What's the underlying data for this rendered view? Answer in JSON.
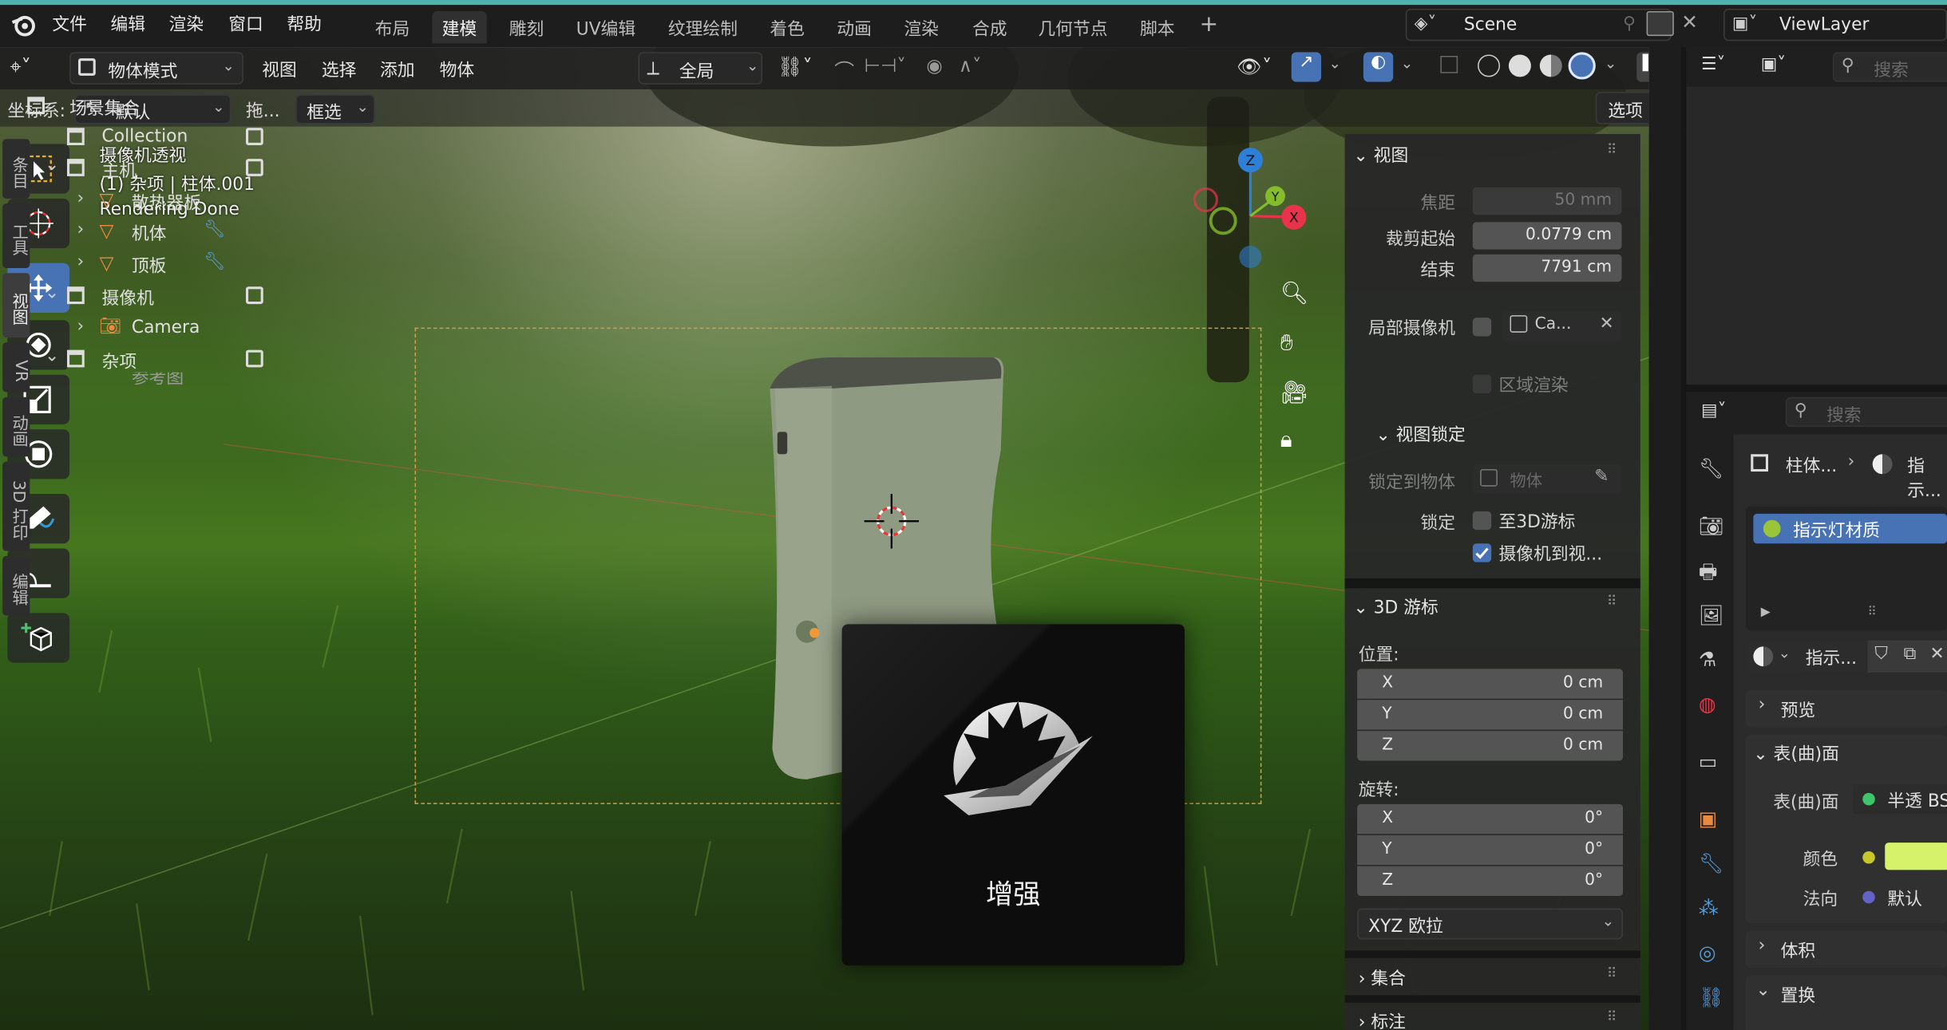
{
  "menubar": {
    "items": [
      "文件",
      "编辑",
      "渲染",
      "窗口",
      "帮助"
    ],
    "workspaces": [
      "布局",
      "建模",
      "雕刻",
      "UV编辑",
      "纹理绘制",
      "着色",
      "动画",
      "渲染",
      "合成",
      "几何节点",
      "脚本"
    ],
    "active_workspace": "建模",
    "scene": "Scene",
    "view_layer": "ViewLayer"
  },
  "viewport_header": {
    "mode": "物体模式",
    "menus": [
      "视图",
      "选择",
      "添加",
      "物体"
    ],
    "transform_orientation": "全局",
    "coord_label": "坐标系:",
    "coord_value": "默认",
    "drag_label": "拖...",
    "select_mode": "框选",
    "options": "选项"
  },
  "hud": {
    "line1": "摄像机透视",
    "line2": "(1) 杂项 | 柱体.001",
    "line3": "Rendering Done"
  },
  "gizmo": {
    "z": "Z",
    "y": "Y",
    "x": "X"
  },
  "n_panel": {
    "view_header": "视图",
    "focal_label": "焦距",
    "focal_value": "50 mm",
    "clip_start_label": "裁剪起始",
    "clip_start_value": "0.0779 cm",
    "clip_end_label": "结束",
    "clip_end_value": "7791 cm",
    "local_camera_label": "局部摄像机",
    "local_camera_value": "Ca...",
    "region_render": "区域渲染",
    "view_lock_header": "视图锁定",
    "lock_object_label": "锁定到物体",
    "lock_object_placeholder": "物体",
    "lock_label": "锁定",
    "lock_to_cursor": "至3D游标",
    "lock_camera": "摄像机到视...",
    "cursor_header": "3D 游标",
    "location_label": "位置:",
    "loc": [
      {
        "axis": "X",
        "value": "0 cm"
      },
      {
        "axis": "Y",
        "value": "0 cm"
      },
      {
        "axis": "Z",
        "value": "0 cm"
      }
    ],
    "rotation_label": "旋转:",
    "rot": [
      {
        "axis": "X",
        "value": "0°"
      },
      {
        "axis": "Y",
        "value": "0°"
      },
      {
        "axis": "Z",
        "value": "0°"
      }
    ],
    "rotation_mode": "XYZ 欧拉",
    "collection_header": "集合",
    "annotation_header": "标注"
  },
  "side_tabs": [
    "条目",
    "工具",
    "视图",
    "VR",
    "动画",
    "3D 打印",
    "编辑"
  ],
  "outliner": {
    "search_placeholder": "搜索",
    "root": "场景集合",
    "rows": [
      "Collection",
      "主机",
      "散热器板",
      "机体",
      "顶板",
      "摄像机",
      "Camera",
      "杂项",
      "参考图"
    ]
  },
  "properties": {
    "search_placeholder": "搜索",
    "breadcrumb_obj": "柱体...",
    "breadcrumb_mat": "指示...",
    "material_slot": "指示灯材质",
    "material_name": "指示...",
    "preview": "预览",
    "surface_header": "表(曲)面",
    "surface_label": "表(曲)面",
    "surface_value": "半透 BS",
    "color_label": "颜色",
    "normal_label": "法向",
    "normal_value": "默认",
    "volume": "体积",
    "displacement": "置换"
  },
  "splash": {
    "label": "增强"
  },
  "colors": {
    "accent": "#4fb2ad",
    "active_blue": "#4772b3",
    "x_axis": "#e8334b",
    "y_axis": "#84bc2d",
    "z_axis": "#2e7fd8",
    "material_color": "#d6f26a"
  }
}
